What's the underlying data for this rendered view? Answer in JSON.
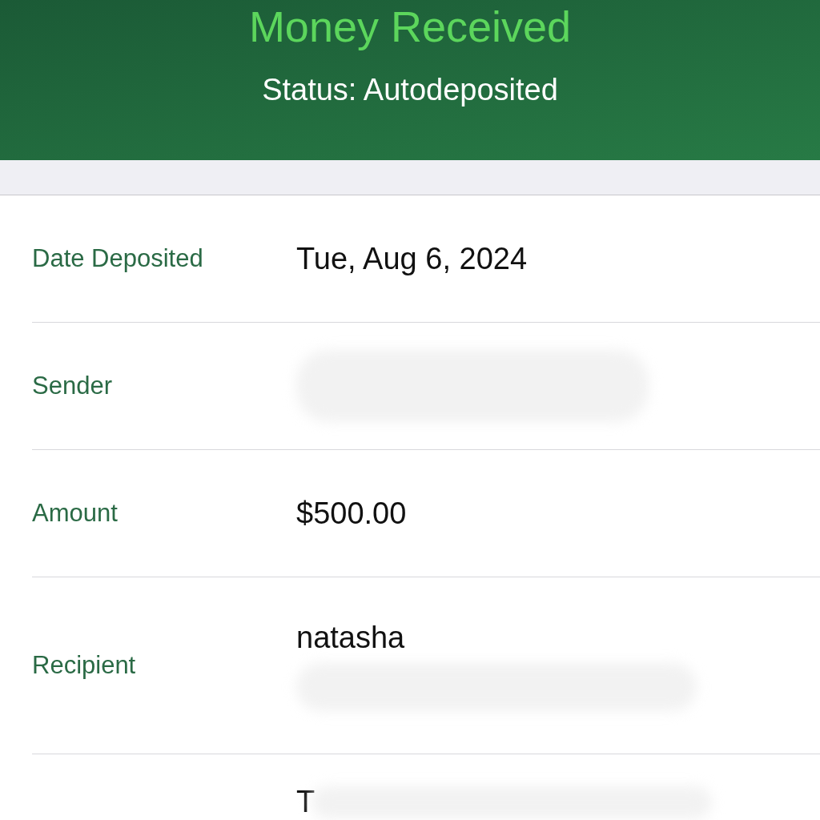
{
  "header": {
    "title": "Money Received",
    "status": "Status: Autodeposited"
  },
  "rows": [
    {
      "label": "Date Deposited",
      "value": "Tue, Aug 6, 2024",
      "redacted": false
    },
    {
      "label": "Sender",
      "redacted": true
    },
    {
      "label": "Amount",
      "value": "$500.00",
      "redacted": false
    },
    {
      "label": "Recipient",
      "value": "natasha",
      "redacted": true
    },
    {
      "value": "T",
      "redacted": true
    }
  ]
}
